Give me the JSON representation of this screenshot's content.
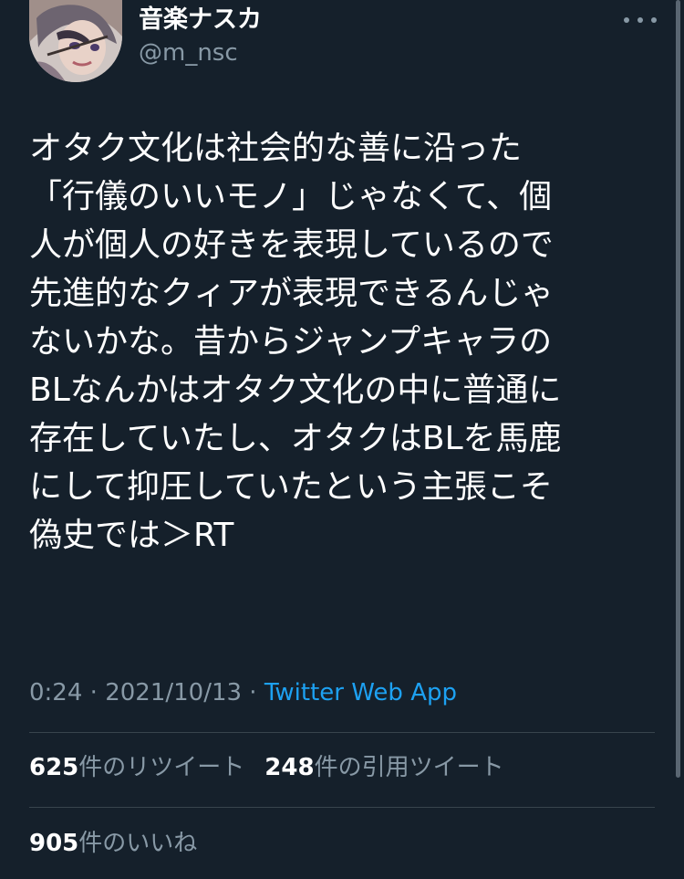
{
  "user": {
    "display_name": "音楽ナスカ",
    "handle": "@m_nsc"
  },
  "tweet": {
    "lines": [
      "オタク文化は社会的な善に沿った",
      "「行儀のいいモノ」じゃなくて、個",
      "人が個人の好きを表現しているので",
      "先進的なクィアが表現できるんじゃ",
      "ないかな。昔からジャンプキャラの",
      "BLなんかはオタク文化の中に普通に",
      "存在していたし、オタクはBLを馬鹿",
      "にして抑圧していたという主張こそ",
      "偽史では＞RT"
    ],
    "time": "0:24",
    "separator1": " · ",
    "date": "2021/10/13",
    "separator2": " · ",
    "source": "Twitter Web App"
  },
  "stats": {
    "retweets_count": "625",
    "retweets_label": "件のリツイート",
    "quotes_count": "248",
    "quotes_label": "件の引用ツイート",
    "likes_count": "905",
    "likes_label": "件のいいね"
  },
  "colors": {
    "background": "#15202b",
    "text_primary": "#ffffff",
    "text_secondary": "#8899a6",
    "accent": "#1da1f2",
    "divider": "#38444d"
  },
  "icons": {
    "more": "more-horizontal-icon"
  }
}
